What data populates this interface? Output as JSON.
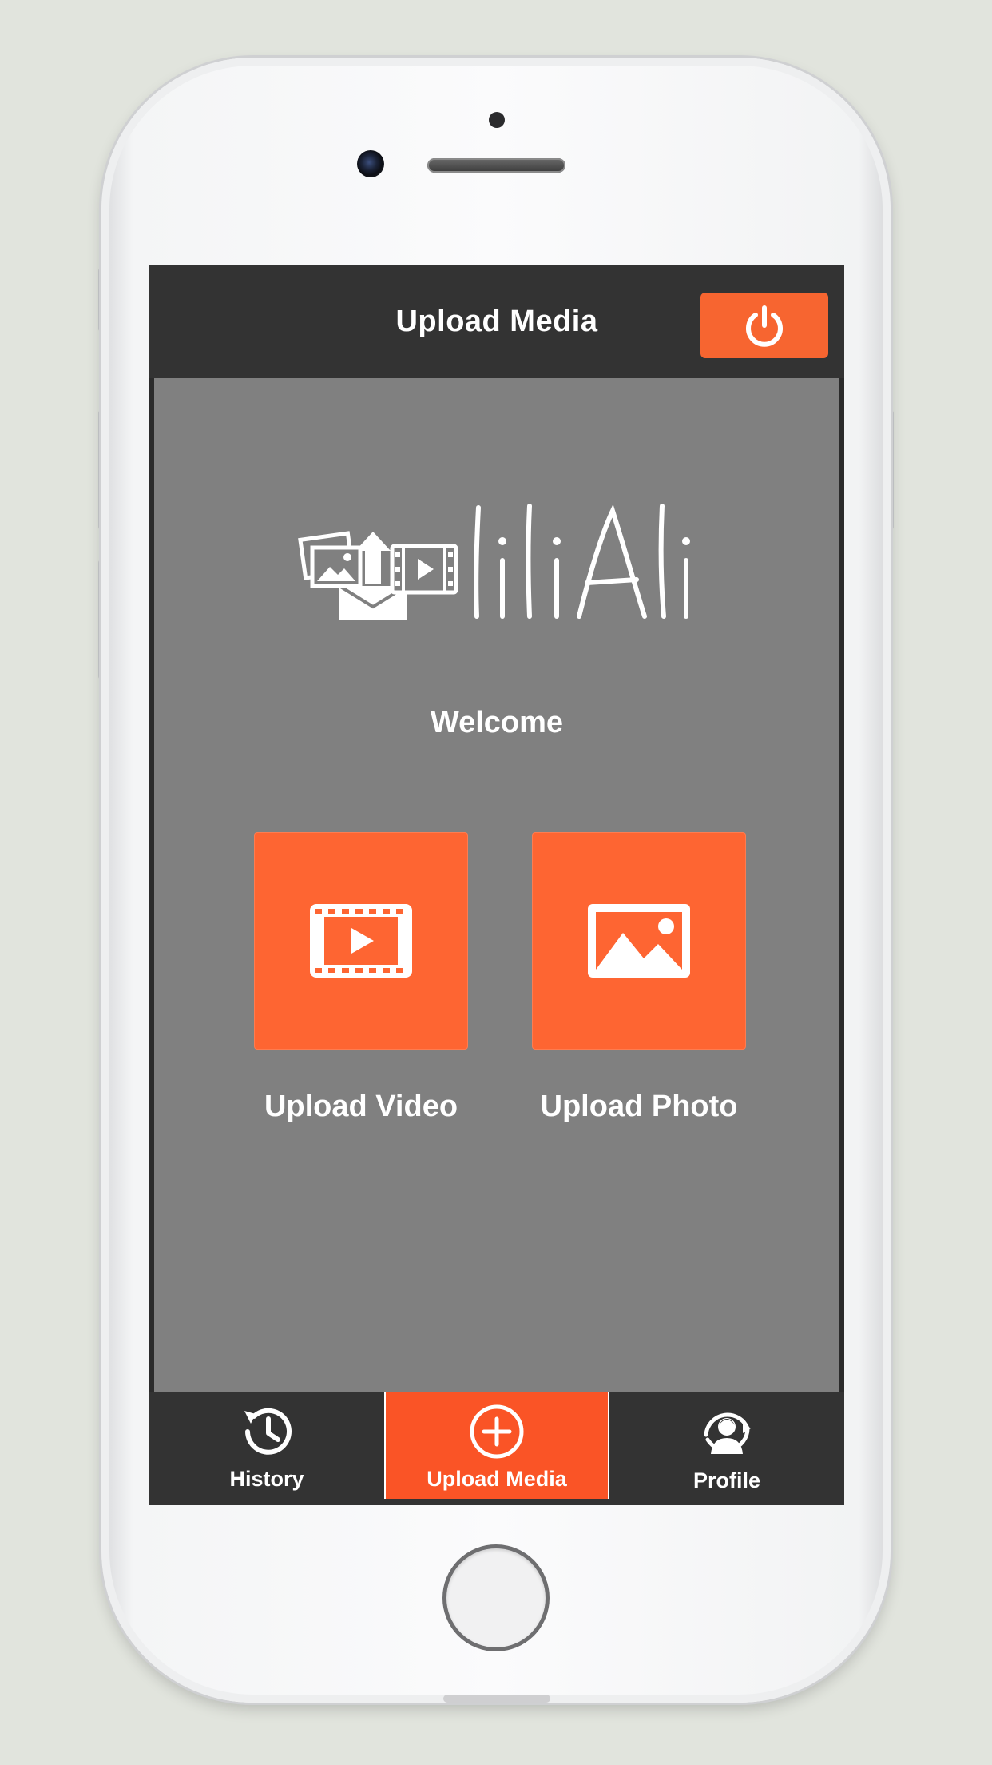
{
  "header": {
    "title": "Upload Media",
    "power_icon": "power-icon"
  },
  "logo": {
    "text": "liliAli",
    "icon": "media-upload-logo-icon"
  },
  "main": {
    "welcome": "Welcome",
    "tiles": [
      {
        "label": "Upload Video",
        "icon": "video-film-icon"
      },
      {
        "label": "Upload Photo",
        "icon": "photo-image-icon"
      }
    ]
  },
  "tabbar": {
    "items": [
      {
        "label": "History",
        "icon": "history-icon",
        "active": false
      },
      {
        "label": "Upload Media",
        "icon": "plus-circle-icon",
        "active": true
      },
      {
        "label": "Profile",
        "icon": "profile-icon",
        "active": false
      }
    ]
  },
  "colors": {
    "accent": "#fe6532",
    "tab_active": "#fa5426",
    "header_bg": "#333333",
    "content_bg": "#808080",
    "page_bg": "#e1e4dd"
  }
}
